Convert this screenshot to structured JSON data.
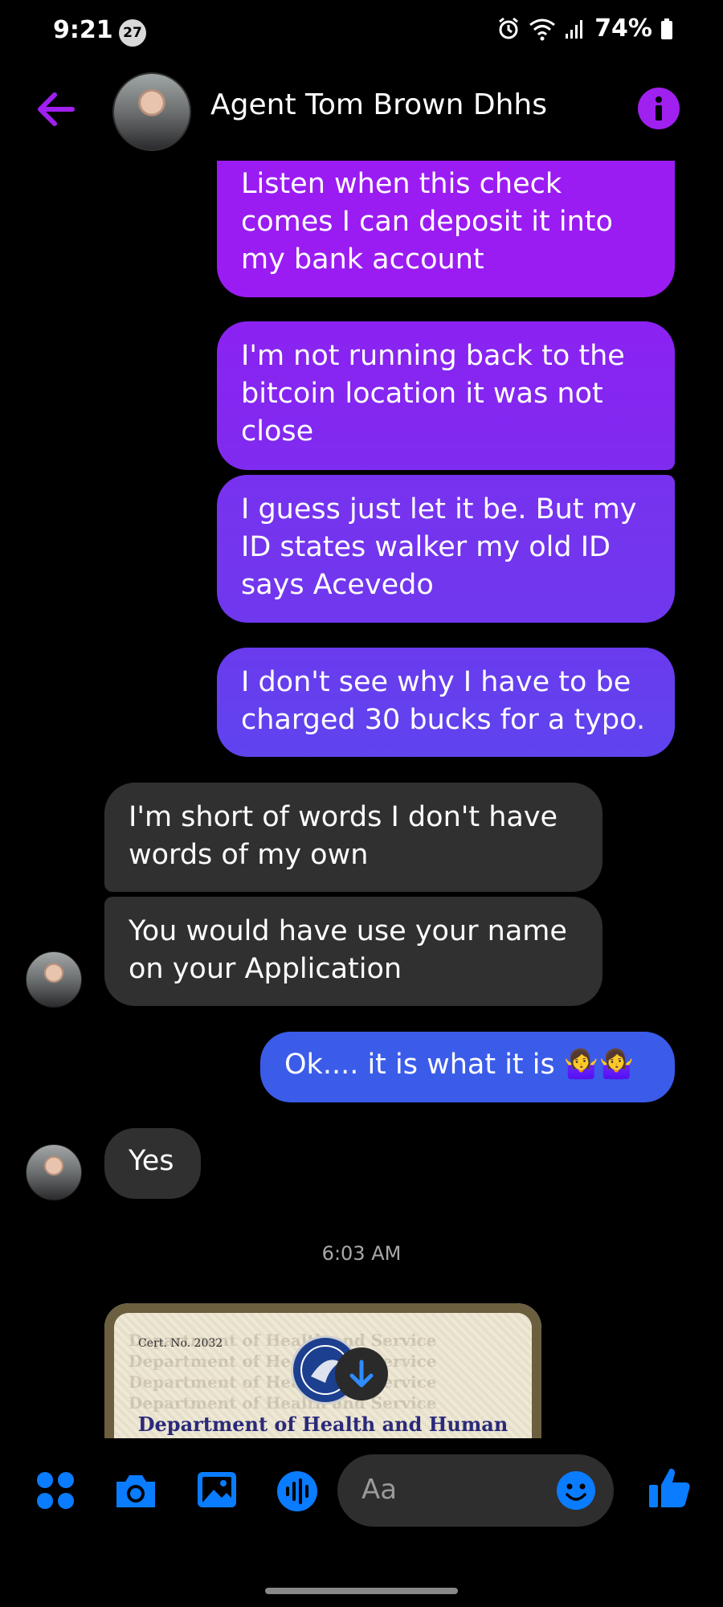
{
  "status_bar": {
    "time": "9:21",
    "notification_count": "27",
    "battery": "74%"
  },
  "header": {
    "contact_name": "Agent Tom Brown Dhhs"
  },
  "messages": [
    {
      "from": "me",
      "text": "Listen when this check comes I can deposit it into my bank account",
      "color": "#9b1cf2"
    },
    {
      "from": "me",
      "text": "I'm not running back to the bitcoin location it was not close",
      "color": "#8a24f0"
    },
    {
      "from": "me",
      "text": "I guess just let it be. But my ID states walker my old ID says Acevedo",
      "color": "#7533ee"
    },
    {
      "from": "me",
      "text": "I don't see why I have to be charged 30 bucks for a typo.",
      "color": "#6a3cee"
    },
    {
      "from": "them",
      "text": "I'm short of words I don't have words of my own"
    },
    {
      "from": "them",
      "text": "You would have use your name on your Application"
    },
    {
      "from": "me",
      "text": "Ok.... it is what it is 🤷‍♀️🤷‍♀️",
      "color": "#3b5ce9"
    },
    {
      "from": "them",
      "text": "Yes"
    }
  ],
  "timestamp": "6:03 AM",
  "attachment": {
    "cert_number": "Cert. No. 2032",
    "title": "Department of Health and Human"
  },
  "composer": {
    "placeholder": "Aa"
  },
  "colors": {
    "accent": "#a020f0",
    "messenger_blue": "#0a7cff",
    "incoming_bubble": "#303030"
  }
}
